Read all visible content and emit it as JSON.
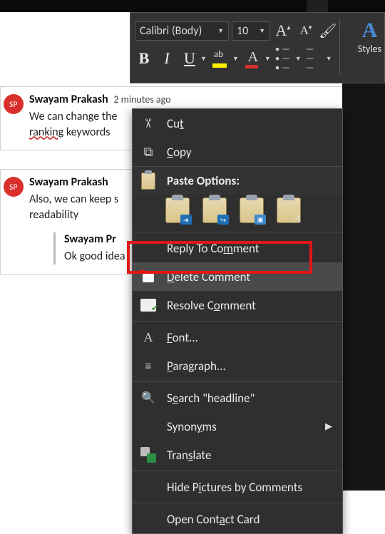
{
  "ribbon": {
    "font_name": "Calibri (Body)",
    "font_size": "10",
    "styles_label": "Styles"
  },
  "comments": [
    {
      "initials": "SP",
      "author": "Swayam Prakash",
      "time": "2 minutes ago",
      "body_prefix": "We can change the ",
      "keyword": "ranking",
      "body_suffix": " keywords"
    },
    {
      "initials": "SP",
      "author": "Swayam Prakash",
      "time": "",
      "body": "Also, we can keep s",
      "body2": "readability",
      "reply": {
        "author": "Swayam Pr",
        "body": "Ok good idea"
      }
    }
  ],
  "ctx": {
    "cut": "Cut",
    "copy": "Copy",
    "paste_options": "Paste Options:",
    "reply": "Reply To Comment",
    "delete": "Delete Comment",
    "resolve": "Resolve Comment",
    "font": "Font...",
    "paragraph": "Paragraph...",
    "search": "Search \"headline\"",
    "synonyms": "Synonyms",
    "translate": "Translate",
    "hide_pictures": "Hide Pictures by Comments",
    "open_contact": "Open Contact Card"
  }
}
